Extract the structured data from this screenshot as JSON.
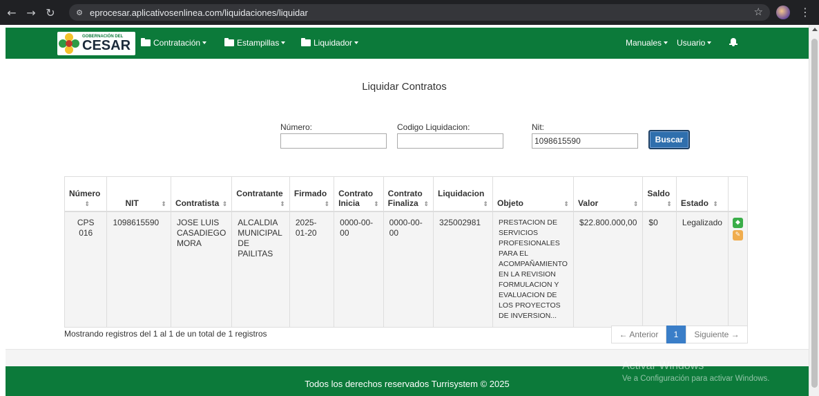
{
  "browser": {
    "url": "eprocesar.aplicativosenlinea.com/liquidaciones/liquidar",
    "back_icon": "back-arrow-icon",
    "forward_icon": "forward-arrow-icon",
    "reload_icon": "reload-icon"
  },
  "navbar": {
    "logo_small": "GOBERNACIÓN DEL",
    "logo_big": "CESAR",
    "menus": [
      "Contratación",
      "Estampillas",
      "Liquidador"
    ],
    "right_menus": [
      "Manuales",
      "Usuario"
    ],
    "color": "#0c7a3a"
  },
  "page": {
    "title": "Liquidar Contratos"
  },
  "search": {
    "numero_label": "Número:",
    "numero_value": "",
    "codigo_label": "Codigo Liquidacion:",
    "codigo_value": "",
    "nit_label": "Nit:",
    "nit_value": "1098615590",
    "button": "Buscar"
  },
  "table": {
    "headers": [
      "Número",
      "NIT",
      "Contratista",
      "Contratante",
      "Firmado",
      "Contrato Inicia",
      "Contrato Finaliza",
      "Liquidacion",
      "Objeto",
      "Valor",
      "Saldo",
      "Estado",
      ""
    ],
    "header_lines": [
      [
        "Número"
      ],
      [
        "NIT"
      ],
      [
        "Contratista"
      ],
      [
        "Contratante"
      ],
      [
        "Firmado"
      ],
      [
        "Contrato",
        "Inicia"
      ],
      [
        "Contrato",
        "Finaliza"
      ],
      [
        "Liquidacion"
      ],
      [
        "Objeto"
      ],
      [
        "Valor"
      ],
      [
        "Saldo"
      ],
      [
        "Estado"
      ],
      [
        ""
      ]
    ],
    "rows": [
      {
        "numero": "CPS 016",
        "nit": "1098615590",
        "contratista": "JOSE LUIS CASADIEGO MORA",
        "contratante": "ALCALDIA MUNICIPAL DE PAILITAS",
        "firmado": "2025-01-20",
        "inicia": "0000-00-00",
        "finaliza": "0000-00-00",
        "liquidacion": "325002981",
        "objeto": "PRESTACION DE SERVICIOS PROFESIONALES PARA EL ACOMPAÑAMIENTO EN LA REVISION FORMULACION Y EVALUACION DE LOS PROYECTOS DE INVERSION...",
        "valor": "$22.800.000,00",
        "saldo": "$0",
        "estado": "Legalizado",
        "actions": [
          "tag-icon",
          "gavel-icon"
        ]
      }
    ]
  },
  "pagination": {
    "info": "Mostrando registros del 1 al 1 de un total de 1 registros",
    "prev": "← Anterior",
    "current": "1",
    "next": "Siguiente →"
  },
  "footer": {
    "text": "Todos los derechos reservados Turrisystem © 2025"
  },
  "watermark": {
    "line1": "Activar Windows",
    "line2": "Ve a Configuración para activar Windows."
  }
}
